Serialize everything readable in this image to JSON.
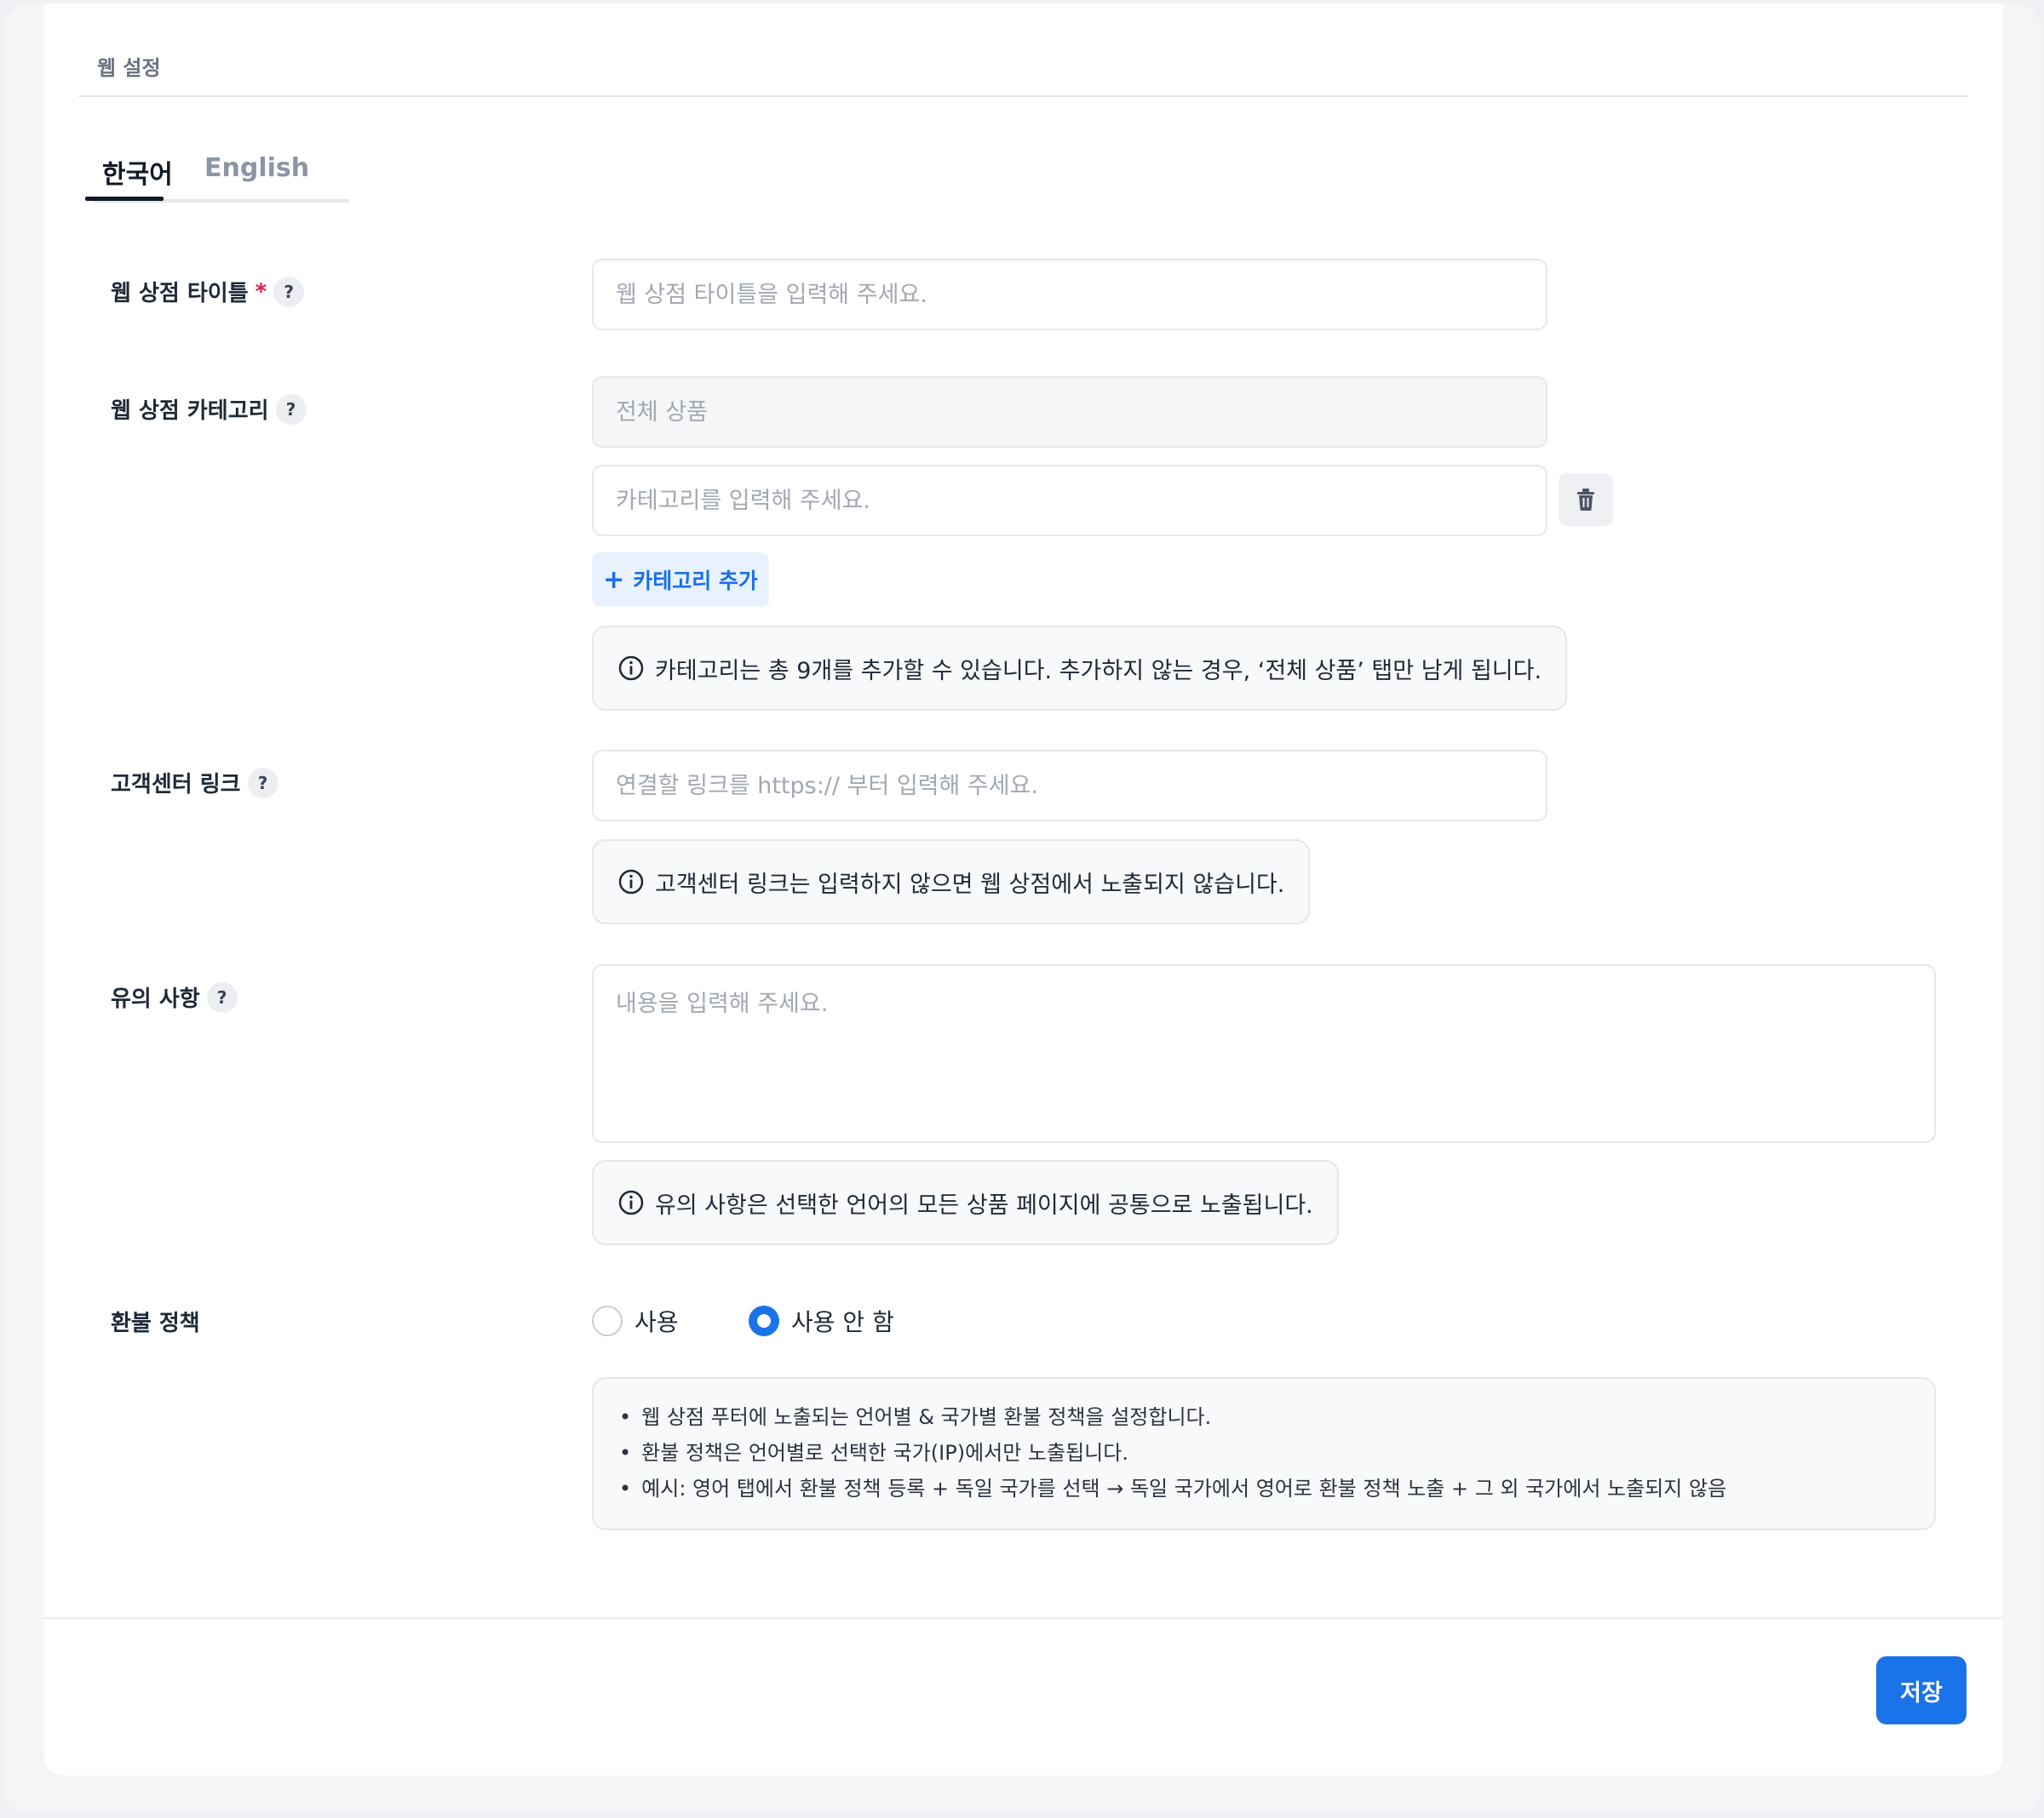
{
  "page": {
    "section_title": "웹 설정"
  },
  "tabs": [
    {
      "label": "한국어",
      "active": true
    },
    {
      "label": "English",
      "active": false
    }
  ],
  "fields": {
    "title": {
      "label": "웹 상점 타이틀",
      "required_mark": "*",
      "help": "?",
      "placeholder": "웹 상점 타이틀을 입력해 주세요."
    },
    "category": {
      "label": "웹 상점 카테고리",
      "help": "?",
      "fixed_value": "전체 상품",
      "placeholder": "카테고리를 입력해 주세요.",
      "add_label": "카테고리 추가",
      "add_icon": "+",
      "info": "카테고리는 총 9개를 추가할 수 있습니다. 추가하지 않는 경우, ‘전체 상품’ 탭만 남게 됩니다."
    },
    "support_link": {
      "label": "고객센터 링크",
      "help": "?",
      "placeholder": "연결할 링크를 https:// 부터 입력해 주세요.",
      "info": "고객센터 링크는 입력하지 않으면 웹 상점에서 노출되지 않습니다."
    },
    "notice": {
      "label": "유의 사항",
      "help": "?",
      "placeholder": "내용을 입력해 주세요.",
      "info": "유의 사항은 선택한 언어의 모든 상품 페이지에 공통으로 노출됩니다."
    },
    "refund": {
      "label": "환불 정책",
      "options": [
        {
          "label": "사용",
          "selected": false
        },
        {
          "label": "사용 안 함",
          "selected": true
        }
      ],
      "notes": [
        "웹 상점 푸터에 노출되는 언어별 & 국가별 환불 정책을 설정합니다.",
        "환불 정책은 언어별로 선택한 국가(IP)에서만 노출됩니다.",
        "예시: 영어 탭에서 환불 정책 등록 + 독일 국가를 선택 → 독일 국가에서 영어로 환불 정책 노출 + 그 외 국가에서 노출되지 않음"
      ]
    }
  },
  "actions": {
    "save_label": "저장"
  },
  "icons": {
    "info": "info-circle-icon",
    "delete": "trash-icon",
    "help": "question-icon"
  },
  "colors": {
    "primary": "#1a73e8",
    "required": "#e11d48",
    "add_button_bg": "#e8f1fe"
  }
}
